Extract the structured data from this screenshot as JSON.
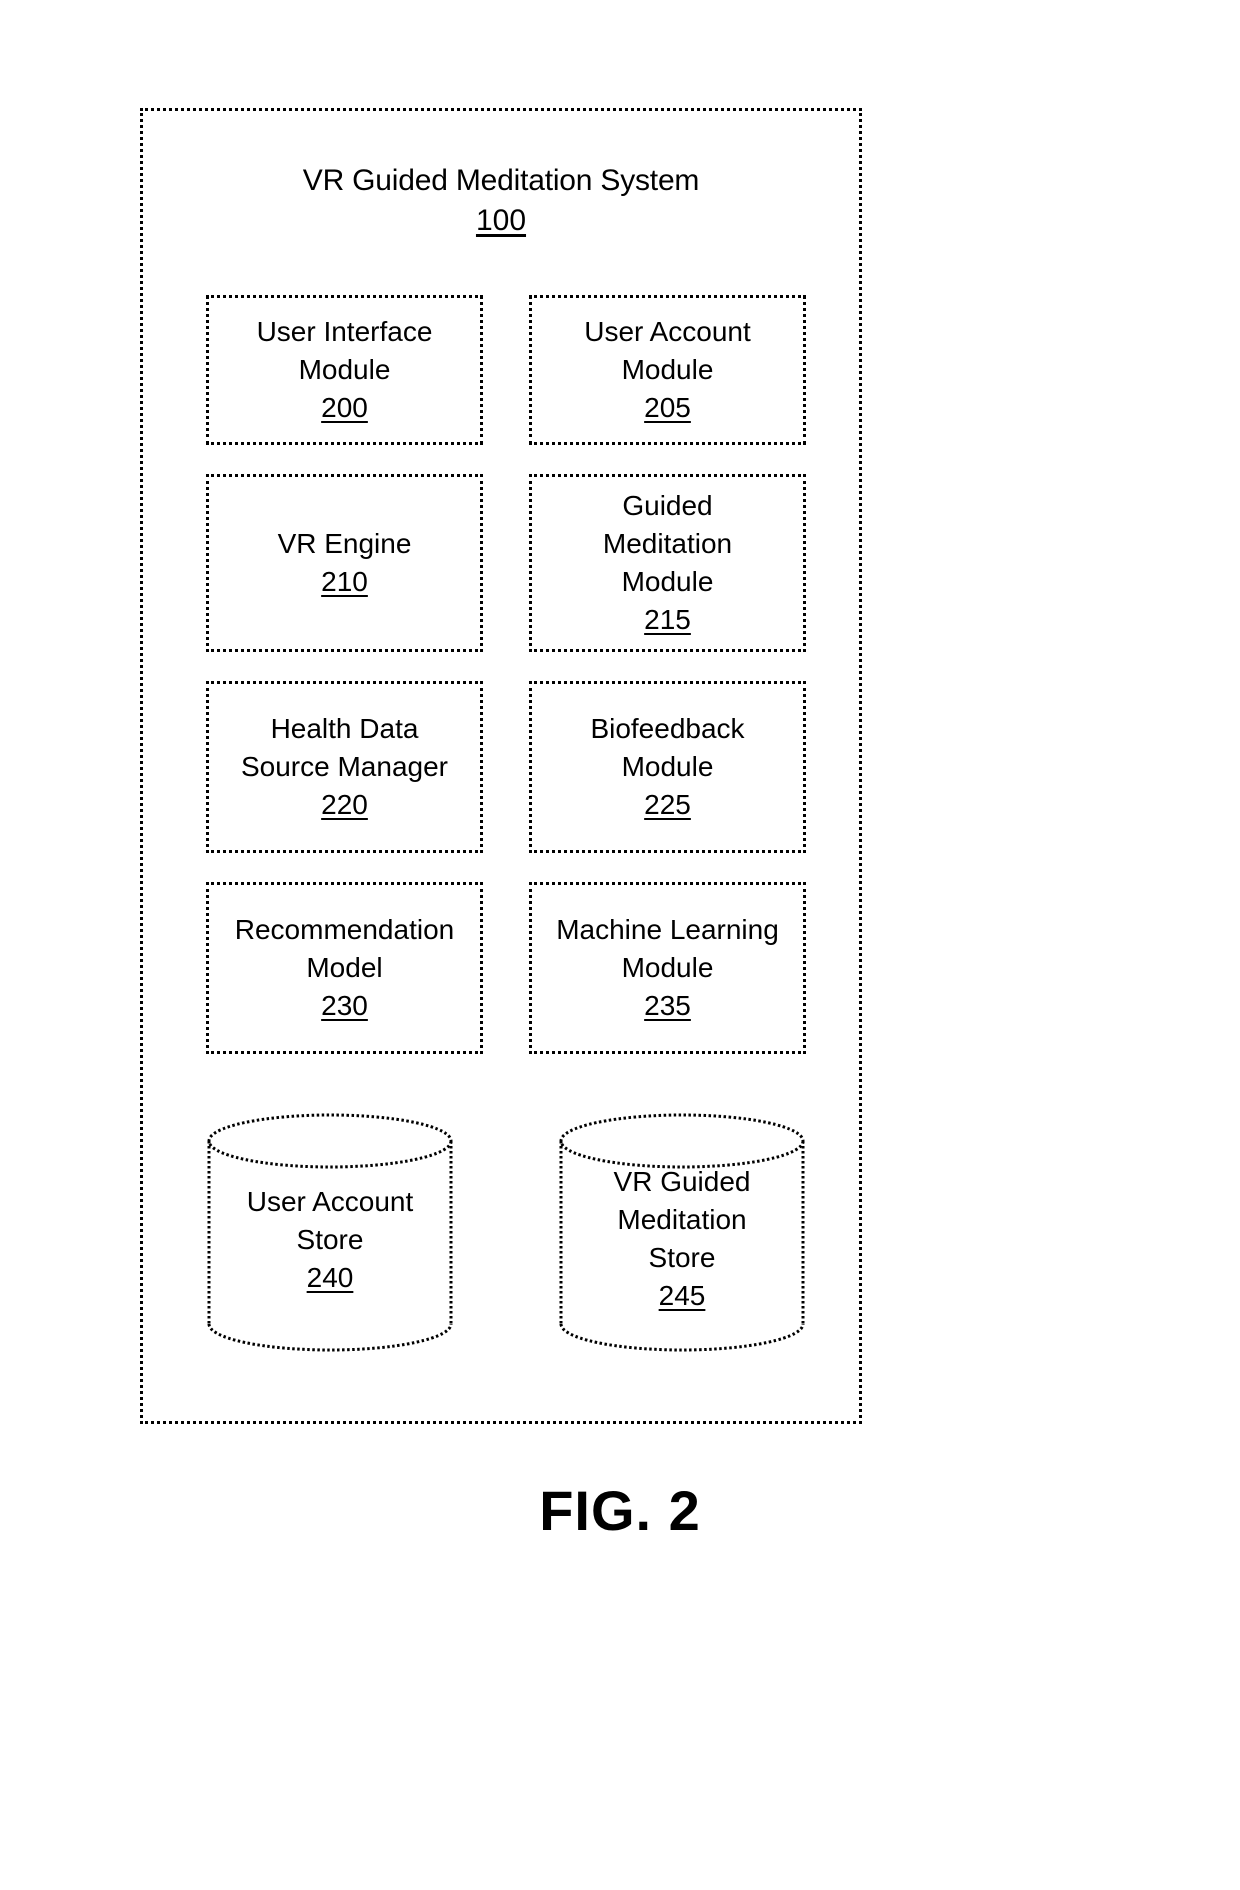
{
  "figure": {
    "caption": "FIG. 2"
  },
  "system": {
    "title": "VR Guided Meditation System",
    "reference": "100"
  },
  "modules": [
    {
      "lines": [
        "User Interface",
        "Module"
      ],
      "reference": "200",
      "name": "user-interface-module"
    },
    {
      "lines": [
        "User Account",
        "Module"
      ],
      "reference": "205",
      "name": "user-account-module"
    },
    {
      "lines": [
        "VR Engine"
      ],
      "reference": "210",
      "name": "vr-engine-module"
    },
    {
      "lines": [
        "Guided",
        "Meditation",
        "Module"
      ],
      "reference": "215",
      "name": "guided-meditation-module"
    },
    {
      "lines": [
        "Health Data",
        "Source Manager"
      ],
      "reference": "220",
      "name": "health-data-source-manager-module"
    },
    {
      "lines": [
        "Biofeedback",
        "Module"
      ],
      "reference": "225",
      "name": "biofeedback-module"
    },
    {
      "lines": [
        "Recommendation",
        "Model"
      ],
      "reference": "230",
      "name": "recommendation-model-module"
    },
    {
      "lines": [
        "Machine Learning",
        "Module"
      ],
      "reference": "235",
      "name": "machine-learning-module"
    }
  ],
  "stores": [
    {
      "lines": [
        "User Account",
        "Store"
      ],
      "reference": "240",
      "name": "user-account-store"
    },
    {
      "lines": [
        "VR Guided",
        "Meditation",
        "Store"
      ],
      "reference": "245",
      "name": "vr-guided-meditation-store"
    }
  ],
  "colors": {
    "stroke": "#000000",
    "background": "#ffffff"
  }
}
